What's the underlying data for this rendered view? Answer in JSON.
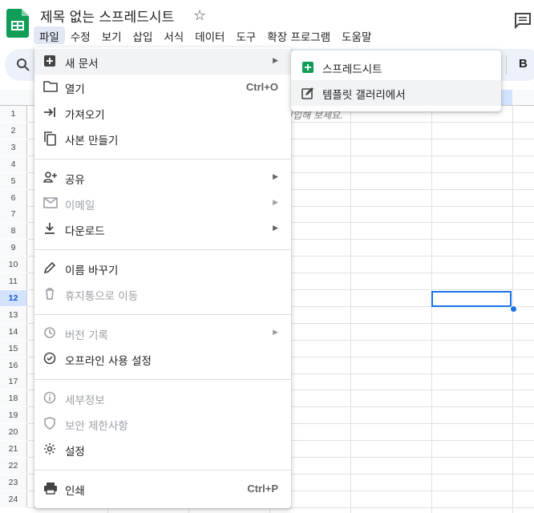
{
  "app": {
    "title": "제목 없는 스프레드시트"
  },
  "menubar": {
    "items": [
      "파일",
      "수정",
      "보기",
      "삽입",
      "서식",
      "데이터",
      "도구",
      "확장 프로그램",
      "도움말"
    ],
    "active": "파일"
  },
  "toolbar": {
    "bold_label": "B"
  },
  "grid": {
    "rows": [
      "1",
      "2",
      "3",
      "4",
      "5",
      "6",
      "7",
      "8",
      "9",
      "10",
      "11",
      "12",
      "13",
      "14",
      "15",
      "16",
      "17",
      "18",
      "19",
      "20",
      "21",
      "22",
      "23",
      "24"
    ],
    "selected_row": "12",
    "hint_text": "/입해 보세요."
  },
  "file_menu": {
    "new": "새 문서",
    "open": "열기",
    "open_shortcut": "Ctrl+O",
    "import": "가져오기",
    "copy": "사본 만들기",
    "share": "공유",
    "email": "이메일",
    "download": "다운로드",
    "rename": "이름 바꾸기",
    "trash": "휴지통으로 이동",
    "version": "버전 기록",
    "offline": "오프라인 사용 설정",
    "details": "세부정보",
    "security": "보안 제한사항",
    "settings": "설정",
    "print": "인쇄",
    "print_shortcut": "Ctrl+P"
  },
  "new_submenu": {
    "spreadsheet": "스프레드시트",
    "template": "템플릿 갤러리에서"
  },
  "colors": {
    "accent": "#1a73e8",
    "sheets_green": "#0f9d58",
    "toolbar_bg": "#edf2fa"
  }
}
